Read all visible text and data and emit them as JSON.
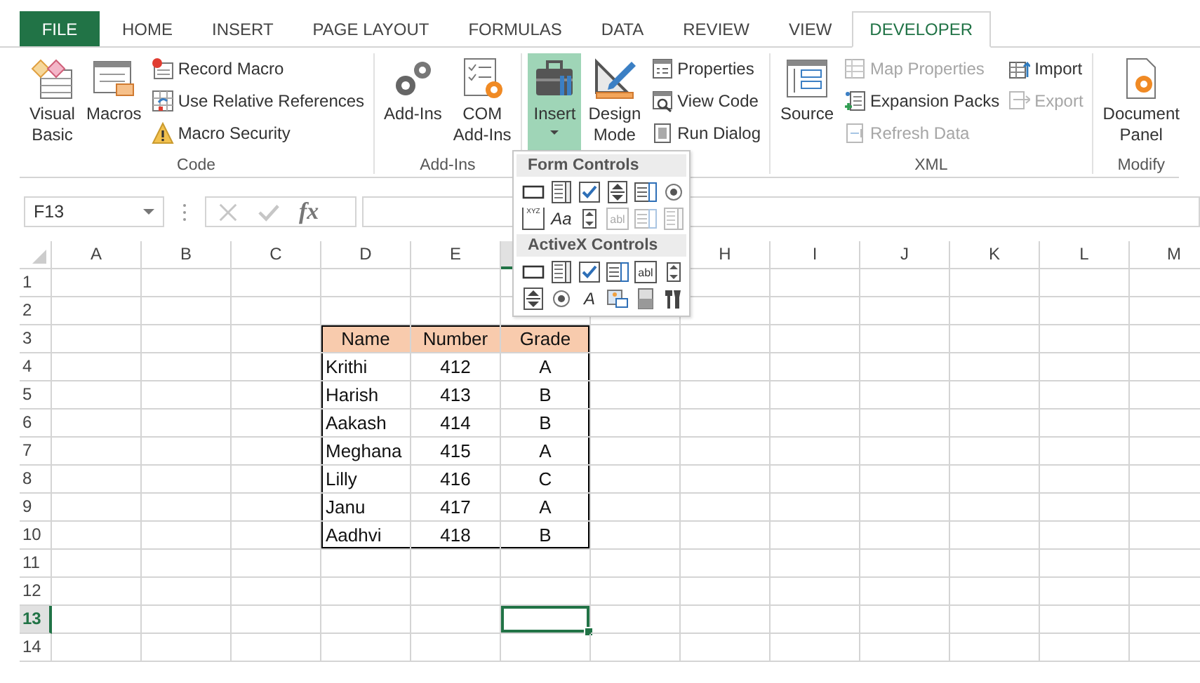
{
  "tabs": [
    {
      "label": "FILE",
      "kind": "file",
      "selected": false
    },
    {
      "label": "HOME",
      "kind": "tab",
      "selected": false
    },
    {
      "label": "INSERT",
      "kind": "tab",
      "selected": false
    },
    {
      "label": "PAGE LAYOUT",
      "kind": "tab",
      "selected": false
    },
    {
      "label": "FORMULAS",
      "kind": "tab",
      "selected": false
    },
    {
      "label": "DATA",
      "kind": "tab",
      "selected": false
    },
    {
      "label": "REVIEW",
      "kind": "tab",
      "selected": false
    },
    {
      "label": "VIEW",
      "kind": "tab",
      "selected": false
    },
    {
      "label": "DEVELOPER",
      "kind": "tab",
      "selected": true
    }
  ],
  "ribbon": {
    "groups": [
      {
        "label": "Code",
        "items": [
          {
            "kind": "large",
            "label": "Visual\nBasic",
            "disabled": false,
            "pressed": false,
            "dropdown": false
          },
          {
            "kind": "large",
            "label": "Macros",
            "disabled": false,
            "pressed": false,
            "dropdown": false
          },
          {
            "kind": "small",
            "label": "Record Macro",
            "disabled": false,
            "pressed": false,
            "dropdown": false
          },
          {
            "kind": "small",
            "label": "Use Relative References",
            "disabled": false,
            "pressed": false,
            "dropdown": false
          },
          {
            "kind": "small",
            "label": "Macro Security",
            "disabled": false,
            "pressed": false,
            "dropdown": false
          }
        ]
      },
      {
        "label": "Add-Ins",
        "items": [
          {
            "kind": "large",
            "label": "Add-Ins",
            "disabled": false,
            "pressed": false,
            "dropdown": false
          },
          {
            "kind": "large",
            "label": "COM\nAdd-Ins",
            "disabled": false,
            "pressed": false,
            "dropdown": false
          }
        ]
      },
      {
        "items": [
          {
            "kind": "large",
            "label": "Insert",
            "disabled": false,
            "pressed": true,
            "dropdown": true
          },
          {
            "kind": "large",
            "label": "Design\nMode",
            "disabled": false,
            "pressed": false,
            "dropdown": false
          },
          {
            "kind": "small",
            "label": "Properties",
            "disabled": false,
            "pressed": false,
            "dropdown": false
          },
          {
            "kind": "small",
            "label": "View Code",
            "disabled": false,
            "pressed": false,
            "dropdown": false
          },
          {
            "kind": "small",
            "label": "Run Dialog",
            "disabled": false,
            "pressed": false,
            "dropdown": false
          }
        ]
      },
      {
        "label": "XML",
        "items": [
          {
            "kind": "large",
            "label": "Source",
            "disabled": false,
            "pressed": false,
            "dropdown": false
          },
          {
            "kind": "small",
            "label": "Map Properties",
            "disabled": true,
            "pressed": false,
            "dropdown": false
          },
          {
            "kind": "small",
            "label": "Expansion Packs",
            "disabled": false,
            "pressed": false,
            "dropdown": false
          },
          {
            "kind": "small",
            "label": "Refresh Data",
            "disabled": true,
            "pressed": false,
            "dropdown": false
          },
          {
            "kind": "small",
            "label": "Import",
            "disabled": false,
            "pressed": false,
            "dropdown": false
          },
          {
            "kind": "small",
            "label": "Export",
            "disabled": true,
            "pressed": false,
            "dropdown": false
          }
        ]
      },
      {
        "label": "Modify",
        "items": [
          {
            "kind": "large",
            "label": "Document\nPanel",
            "disabled": false,
            "pressed": false,
            "dropdown": false
          }
        ]
      }
    ]
  },
  "insert_menu": {
    "sections": [
      {
        "title": "Form Controls",
        "controls": [
          {
            "kind": "button",
            "disabled": false
          },
          {
            "kind": "combo",
            "disabled": false
          },
          {
            "kind": "check",
            "disabled": false
          },
          {
            "kind": "spin",
            "disabled": false
          },
          {
            "kind": "list",
            "disabled": false
          },
          {
            "kind": "option",
            "disabled": false
          },
          {
            "kind": "group",
            "glyph": "XYZ",
            "disabled": false
          },
          {
            "kind": "label",
            "glyph": "Aa",
            "disabled": false
          },
          {
            "kind": "scroll",
            "disabled": false
          },
          {
            "kind": "text",
            "glyph": "abl",
            "disabled": true
          },
          {
            "kind": "list",
            "disabled": true
          },
          {
            "kind": "combo",
            "disabled": true
          }
        ]
      },
      {
        "title": "ActiveX Controls",
        "controls": [
          {
            "kind": "button",
            "disabled": false
          },
          {
            "kind": "combo",
            "disabled": false
          },
          {
            "kind": "check",
            "disabled": false
          },
          {
            "kind": "list",
            "disabled": false
          },
          {
            "kind": "text",
            "glyph": "abl",
            "disabled": false
          },
          {
            "kind": "scroll",
            "disabled": false
          },
          {
            "kind": "spin",
            "disabled": false
          },
          {
            "kind": "option",
            "disabled": false
          },
          {
            "kind": "label",
            "glyph": "A",
            "disabled": false
          },
          {
            "kind": "image",
            "disabled": false
          },
          {
            "kind": "toggle",
            "disabled": false
          },
          {
            "kind": "more",
            "disabled": false
          }
        ]
      }
    ]
  },
  "formula_bar": {
    "name_box": "F13",
    "function_label": "fx"
  },
  "sheet": {
    "columns": [
      {
        "label": "A",
        "selected": false
      },
      {
        "label": "B",
        "selected": false
      },
      {
        "label": "C",
        "selected": false
      },
      {
        "label": "D",
        "selected": false
      },
      {
        "label": "E",
        "selected": false
      },
      {
        "selected": true
      },
      {
        "selected": false
      },
      {
        "label": "H",
        "selected": false
      },
      {
        "label": "I",
        "selected": false
      },
      {
        "label": "J",
        "selected": false
      },
      {
        "label": "K",
        "selected": false
      },
      {
        "label": "L",
        "selected": false
      },
      {
        "label": "M",
        "selected": false
      }
    ],
    "rows": [
      {
        "label": "1",
        "selected": false
      },
      {
        "label": "2",
        "selected": false
      },
      {
        "label": "3",
        "selected": false
      },
      {
        "label": "4",
        "selected": false
      },
      {
        "label": "5",
        "selected": false
      },
      {
        "label": "6",
        "selected": false
      },
      {
        "label": "7",
        "selected": false
      },
      {
        "label": "8",
        "selected": false
      },
      {
        "label": "9",
        "selected": false
      },
      {
        "label": "10",
        "selected": false
      },
      {
        "label": "11",
        "selected": false
      },
      {
        "label": "12",
        "selected": false
      },
      {
        "label": "13",
        "selected": true
      },
      {
        "label": "14",
        "selected": false
      }
    ],
    "table": {
      "columns": [
        "Name",
        "Number",
        "Grade"
      ],
      "rows": [
        [
          "Krithi",
          "412",
          "A"
        ],
        [
          "Harish",
          "413",
          "B"
        ],
        [
          "Aakash",
          "414",
          "B"
        ],
        [
          "Meghana",
          "415",
          "A"
        ],
        [
          "Lilly",
          "416",
          "C"
        ],
        [
          "Janu",
          "417",
          "A"
        ],
        [
          "Aadhvi",
          "418",
          "B"
        ]
      ]
    }
  }
}
